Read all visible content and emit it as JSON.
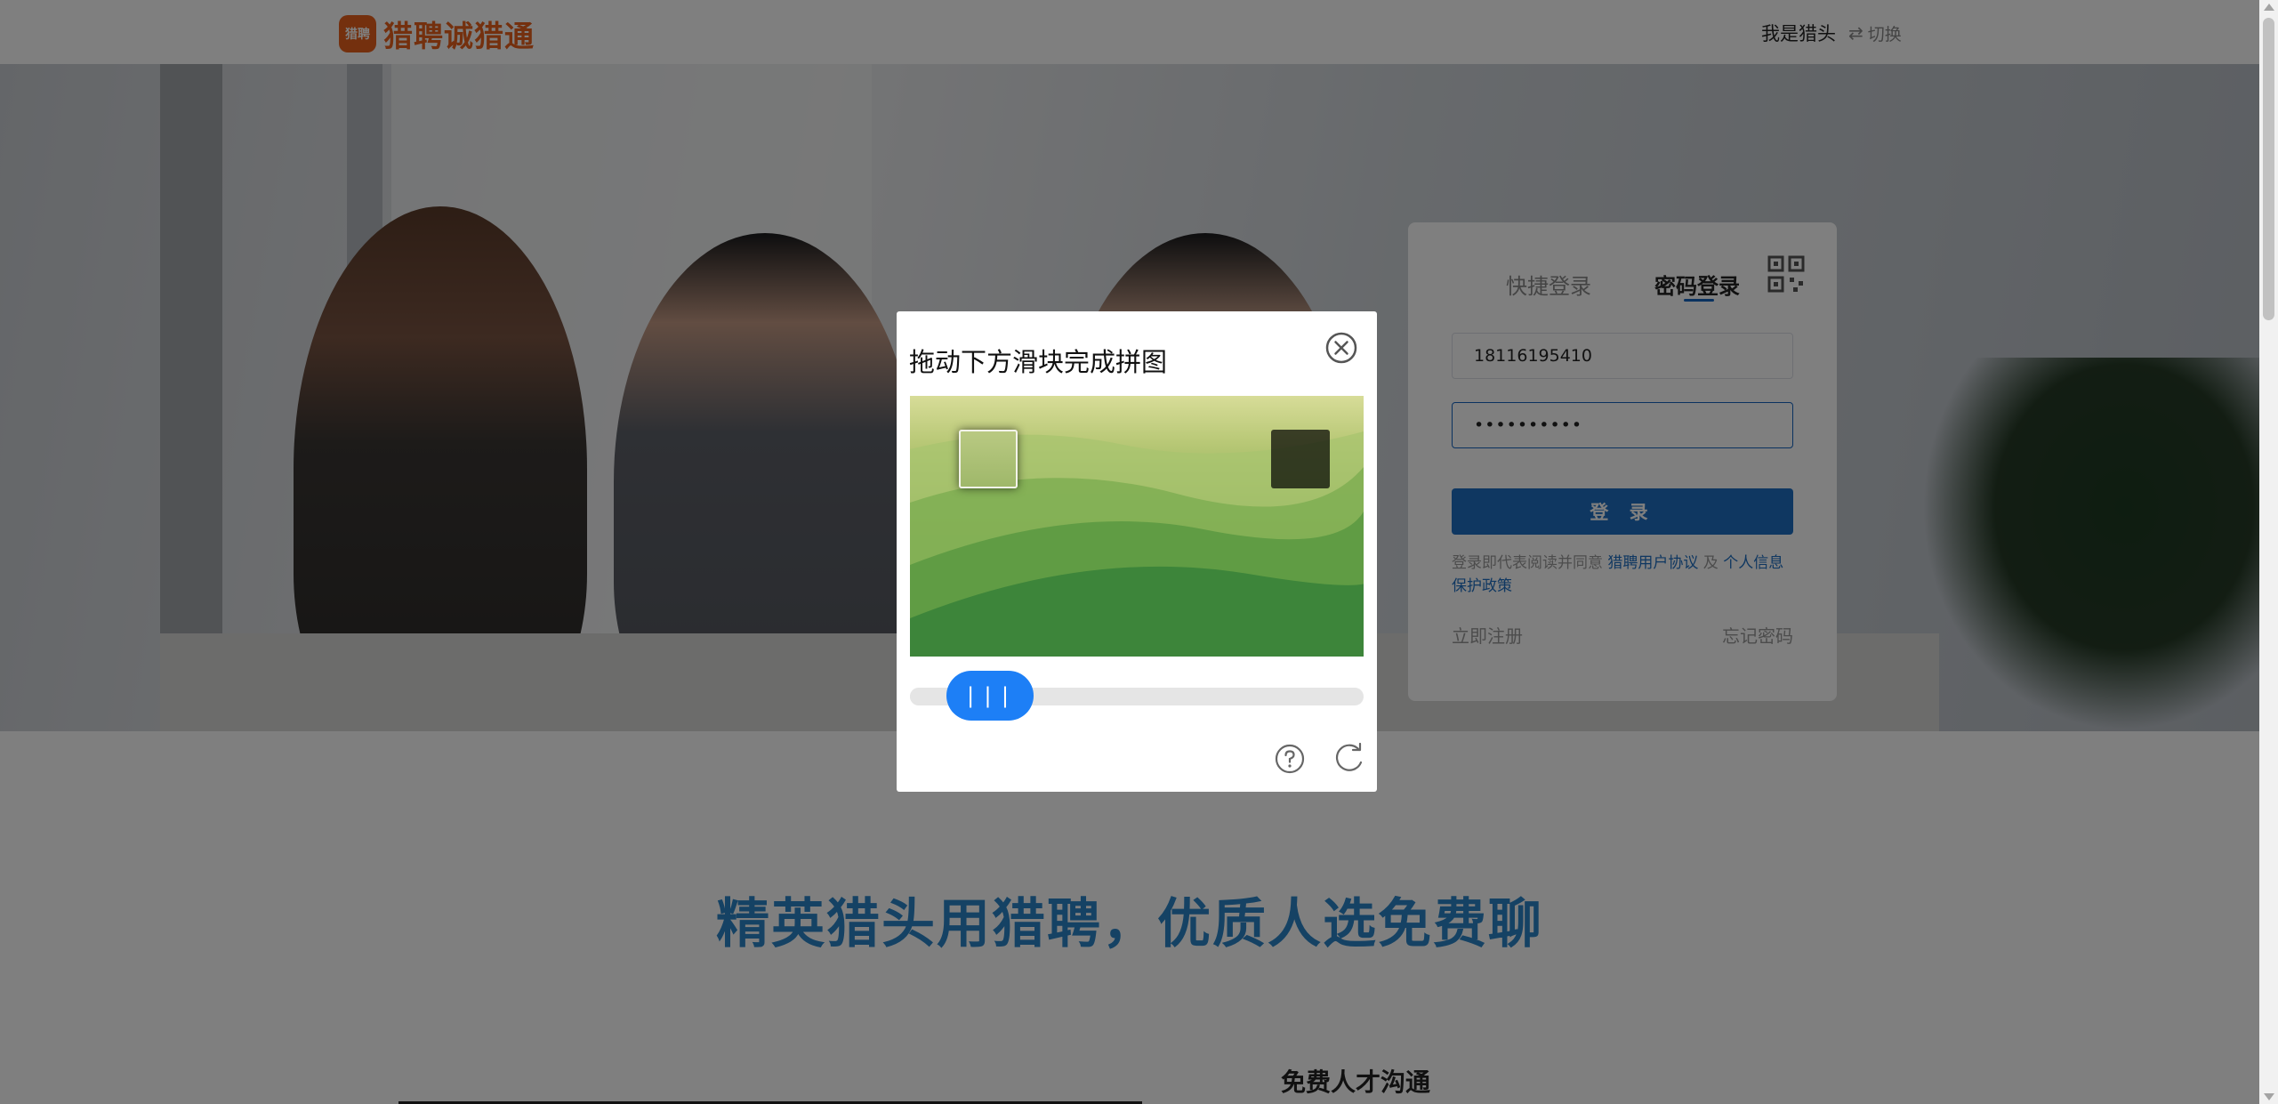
{
  "header": {
    "logo_badge": "猎聘",
    "logo_text": "猎聘诚猎通",
    "role_label": "我是猎头",
    "switch_label": "切换"
  },
  "login": {
    "tab_quick": "快捷登录",
    "tab_password": "密码登录",
    "phone_value": "18116195410",
    "password_value": "••••••••••",
    "login_button": "登 录",
    "agreement_prefix": "登录即代表阅读并同意 ",
    "agreement_link1": "猎聘用户协议",
    "agreement_mid": " 及 ",
    "agreement_link2": "个人信息保护政策",
    "register": "立即注册",
    "forgot": "忘记密码"
  },
  "page": {
    "slogan": "精英猎头用猎聘，优质人选免费聊",
    "feature_title": "免费人才沟通"
  },
  "captcha": {
    "title": "拖动下方滑块完成拼图",
    "handle_label": "|||",
    "slider_progress": 0.1
  },
  "colors": {
    "brand_orange": "#e8601c",
    "primary_blue": "#1e6fc2",
    "slider_blue": "#1d7ff6",
    "slogan_blue": "#2a84c8"
  }
}
